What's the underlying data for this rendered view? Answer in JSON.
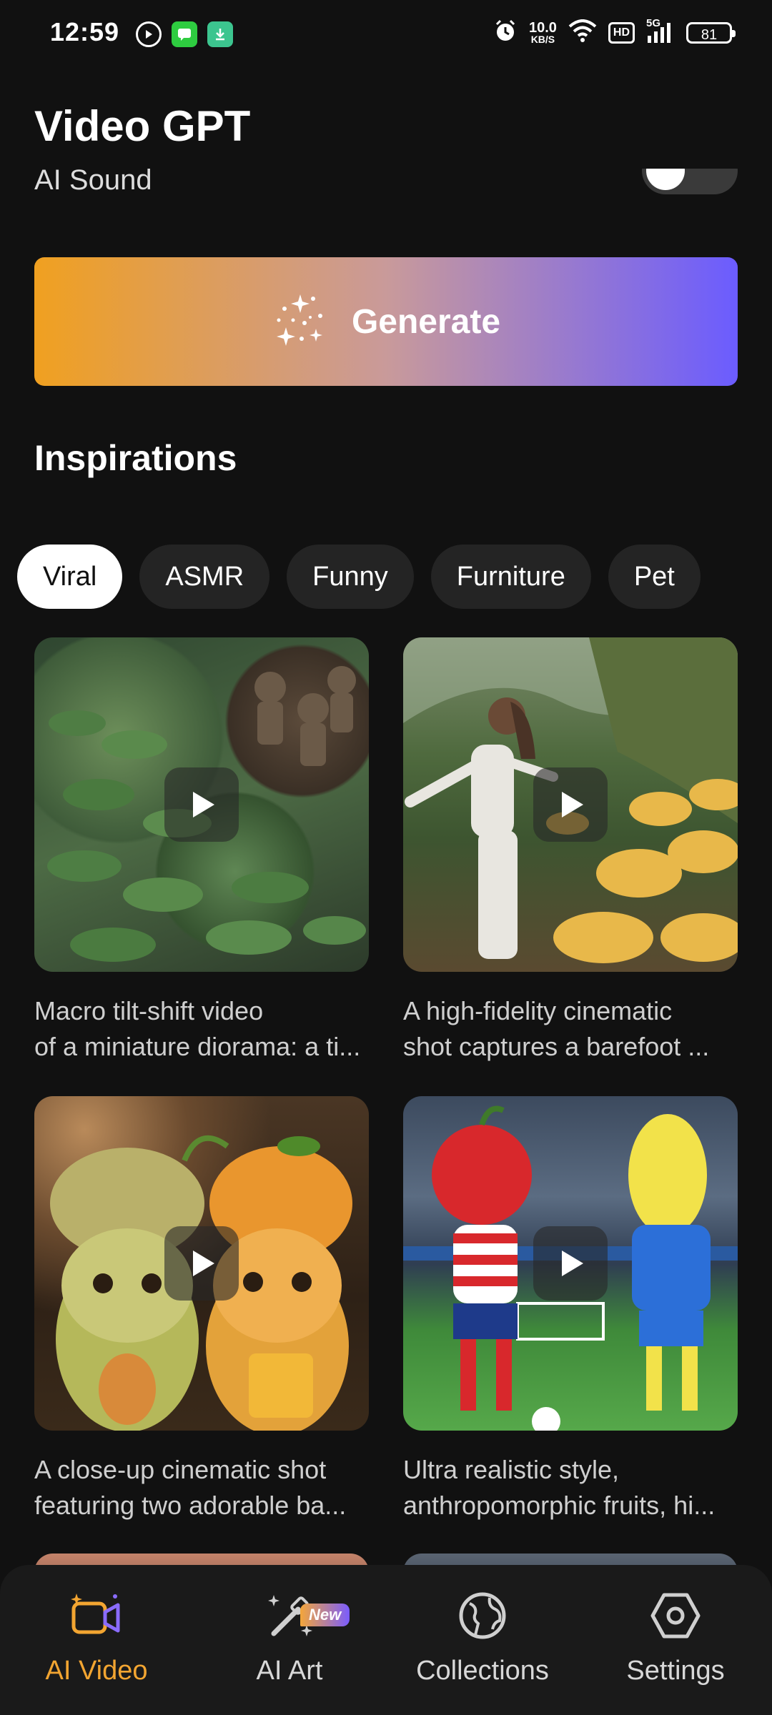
{
  "status_bar": {
    "time": "12:59",
    "net_speed_value": "10.0",
    "net_speed_unit": "KB/S",
    "hd_label": "HD",
    "signal_label": "5G",
    "battery": "81"
  },
  "header": {
    "title": "Video GPT"
  },
  "ai_sound": {
    "label": "AI Sound",
    "enabled": false
  },
  "generate": {
    "label": "Generate"
  },
  "inspirations": {
    "title": "Inspirations",
    "chips": [
      "Viral",
      "ASMR",
      "Funny",
      "Furniture",
      "Pet"
    ],
    "selected_chip": "Viral",
    "cards": [
      {
        "line1": "Macro tilt-shift video",
        "line2": "of a miniature diorama: a ti..."
      },
      {
        "line1": "A high-fidelity cinematic",
        "line2": "shot captures a barefoot ..."
      },
      {
        "line1": "A close-up cinematic shot",
        "line2": "featuring two adorable ba..."
      },
      {
        "line1": "Ultra realistic style,",
        "line2": "anthropomorphic fruits, hi..."
      }
    ]
  },
  "bottom_nav": {
    "items": [
      {
        "label": "AI Video",
        "icon": "video-camera-icon",
        "active": true
      },
      {
        "label": "AI Art",
        "icon": "magic-wand-icon",
        "badge": "New"
      },
      {
        "label": "Collections",
        "icon": "globe-icon"
      },
      {
        "label": "Settings",
        "icon": "hexagon-gear-icon"
      }
    ]
  },
  "colors": {
    "background": "#111111",
    "accent": "#f2a531",
    "gradient_start": "#f0a020",
    "gradient_end": "#6b5cff"
  }
}
